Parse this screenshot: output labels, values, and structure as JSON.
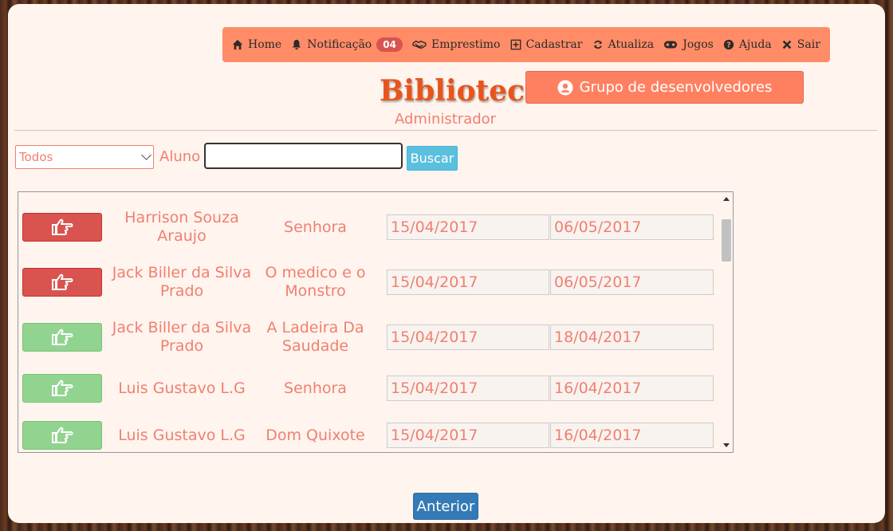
{
  "nav": {
    "items": [
      {
        "label": "Home",
        "icon": "home-icon"
      },
      {
        "label": "Notificação",
        "icon": "bell-icon",
        "badge": "04"
      },
      {
        "label": "Emprestimo",
        "icon": "handshake-icon"
      },
      {
        "label": "Cadastrar",
        "icon": "plus-square-icon"
      },
      {
        "label": "Atualiza",
        "icon": "refresh-icon"
      },
      {
        "label": "Jogos",
        "icon": "gamepad-icon"
      },
      {
        "label": "Ajuda",
        "icon": "question-circle-icon"
      },
      {
        "label": "Sair",
        "icon": "close-icon"
      }
    ]
  },
  "header": {
    "brand": "Biblioteca",
    "role": "Administrador",
    "dev_button": "Grupo de desenvolvedores"
  },
  "search": {
    "filter_selected": "Todos",
    "aluno_label": "Aluno",
    "aluno_value": "",
    "buscar_label": "Buscar"
  },
  "loans": [
    {
      "status": "red",
      "student": "Harrison Souza Araujo",
      "book": "Senhora",
      "loan_date": "15/04/2017",
      "return_date": "06/05/2017"
    },
    {
      "status": "red",
      "student": "Jack Biller da Silva Prado",
      "book": "O medico e o Monstro",
      "loan_date": "15/04/2017",
      "return_date": "06/05/2017"
    },
    {
      "status": "green",
      "student": "Jack Biller da Silva Prado",
      "book": "A Ladeira Da Saudade",
      "loan_date": "15/04/2017",
      "return_date": "18/04/2017"
    },
    {
      "status": "green",
      "student": "Luis Gustavo L.G",
      "book": "Senhora",
      "loan_date": "15/04/2017",
      "return_date": "16/04/2017"
    },
    {
      "status": "green",
      "student": "Luis Gustavo L.G",
      "book": "Dom Quixote",
      "loan_date": "15/04/2017",
      "return_date": "16/04/2017"
    }
  ],
  "colors": {
    "nav_bg": "#ff8c66",
    "brand": "#e8541c",
    "text_accent": "#f08070",
    "danger": "#d9534f",
    "success": "#90d48f",
    "primary": "#337ab7",
    "info": "#5bc0de"
  },
  "pager": {
    "prev_label": "Anterior"
  }
}
